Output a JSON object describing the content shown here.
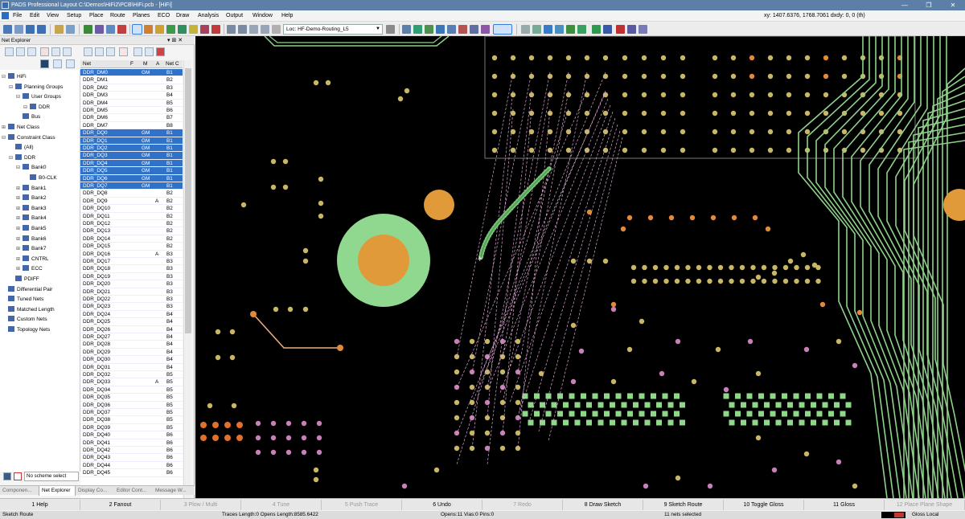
{
  "window": {
    "title": "PADS Professional Layout  C:\\Demos\\HiFi2\\PCB\\HiFi.pcb - [HiFi]",
    "min": "—",
    "restore": "❐",
    "close": "✕"
  },
  "menu": {
    "items": [
      "File",
      "Edit",
      "View",
      "Setup",
      "Place",
      "Route",
      "Planes",
      "ECO",
      "Draw",
      "Analysis",
      "Output",
      "Window",
      "Help"
    ],
    "coords": "xy: 1407.6376, 1768.7061  dxdy: 0, 0  (th)"
  },
  "toolbar": {
    "layer_select": "Loc: HF-Demo-Routing_L5"
  },
  "net_explorer": {
    "title": "Net Explorer",
    "pin": "▾ ⊞ ✕",
    "tree": [
      {
        "label": "HiFi",
        "indent": 0,
        "pm": "⊟"
      },
      {
        "label": "Planning Groups",
        "indent": 1,
        "pm": "⊟"
      },
      {
        "label": "User Groups",
        "indent": 2,
        "pm": "⊟"
      },
      {
        "label": "DDR",
        "indent": 3,
        "pm": "⊟"
      },
      {
        "label": "Bus",
        "indent": 2,
        "pm": ""
      },
      {
        "label": "Net Class",
        "indent": 0,
        "pm": "⊞"
      },
      {
        "label": "Constraint Class",
        "indent": 0,
        "pm": "⊟"
      },
      {
        "label": "(All)",
        "indent": 1,
        "pm": ""
      },
      {
        "label": "DDR",
        "indent": 1,
        "pm": "⊟"
      },
      {
        "label": "Bank0",
        "indent": 2,
        "pm": "⊟"
      },
      {
        "label": "B0-CLK",
        "indent": 3,
        "pm": ""
      },
      {
        "label": "Bank1",
        "indent": 2,
        "pm": "⊞"
      },
      {
        "label": "Bank2",
        "indent": 2,
        "pm": "⊞"
      },
      {
        "label": "Bank3",
        "indent": 2,
        "pm": "⊞"
      },
      {
        "label": "Bank4",
        "indent": 2,
        "pm": "⊞"
      },
      {
        "label": "Bank5",
        "indent": 2,
        "pm": "⊞"
      },
      {
        "label": "Bank6",
        "indent": 2,
        "pm": "⊞"
      },
      {
        "label": "Bank7",
        "indent": 2,
        "pm": "⊞"
      },
      {
        "label": "CNTRL",
        "indent": 2,
        "pm": "⊞"
      },
      {
        "label": "ECC",
        "indent": 2,
        "pm": "⊞"
      },
      {
        "label": "PDIFF",
        "indent": 1,
        "pm": ""
      },
      {
        "label": "Differential Pair",
        "indent": 0,
        "pm": ""
      },
      {
        "label": "Tuned Nets",
        "indent": 0,
        "pm": ""
      },
      {
        "label": "Matched Length",
        "indent": 0,
        "pm": ""
      },
      {
        "label": "Custom Nets",
        "indent": 0,
        "pm": ""
      },
      {
        "label": "Topology Nets",
        "indent": 0,
        "pm": ""
      }
    ],
    "grid_headers": {
      "net": "Net",
      "f": "F",
      "m": "M",
      "a": "A",
      "netc": "Net C"
    },
    "grid_rows": [
      {
        "net": "DDR_DM0",
        "f": "",
        "m": "GM",
        "a": "",
        "nc": "B1",
        "sel": true
      },
      {
        "net": "DDR_DM1",
        "f": "",
        "m": "",
        "a": "",
        "nc": "B2",
        "sel": false
      },
      {
        "net": "DDR_DM2",
        "f": "",
        "m": "",
        "a": "",
        "nc": "B3",
        "sel": false
      },
      {
        "net": "DDR_DM3",
        "f": "",
        "m": "",
        "a": "",
        "nc": "B4",
        "sel": false
      },
      {
        "net": "DDR_DM4",
        "f": "",
        "m": "",
        "a": "",
        "nc": "B5",
        "sel": false
      },
      {
        "net": "DDR_DM5",
        "f": "",
        "m": "",
        "a": "",
        "nc": "B6",
        "sel": false
      },
      {
        "net": "DDR_DM6",
        "f": "",
        "m": "",
        "a": "",
        "nc": "B7",
        "sel": false
      },
      {
        "net": "DDR_DM7",
        "f": "",
        "m": "",
        "a": "",
        "nc": "B8",
        "sel": false
      },
      {
        "net": "DDR_DQ0",
        "f": "",
        "m": "GM",
        "a": "",
        "nc": "B1",
        "sel": true
      },
      {
        "net": "DDR_DQ1",
        "f": "",
        "m": "GM",
        "a": "",
        "nc": "B1",
        "sel": true
      },
      {
        "net": "DDR_DQ2",
        "f": "",
        "m": "GM",
        "a": "",
        "nc": "B1",
        "sel": true
      },
      {
        "net": "DDR_DQ3",
        "f": "",
        "m": "GM",
        "a": "",
        "nc": "B1",
        "sel": true
      },
      {
        "net": "DDR_DQ4",
        "f": "",
        "m": "GM",
        "a": "",
        "nc": "B1",
        "sel": true
      },
      {
        "net": "DDR_DQ5",
        "f": "",
        "m": "GM",
        "a": "",
        "nc": "B1",
        "sel": true
      },
      {
        "net": "DDR_DQ6",
        "f": "",
        "m": "GM",
        "a": "",
        "nc": "B1",
        "sel": true
      },
      {
        "net": "DDR_DQ7",
        "f": "",
        "m": "GM",
        "a": "",
        "nc": "B1",
        "sel": true
      },
      {
        "net": "DDR_DQ8",
        "f": "",
        "m": "",
        "a": "",
        "nc": "B2",
        "sel": false
      },
      {
        "net": "DDR_DQ9",
        "f": "",
        "m": "",
        "a": "A",
        "nc": "B2",
        "sel": false
      },
      {
        "net": "DDR_DQ10",
        "f": "",
        "m": "",
        "a": "",
        "nc": "B2",
        "sel": false
      },
      {
        "net": "DDR_DQ11",
        "f": "",
        "m": "",
        "a": "",
        "nc": "B2",
        "sel": false
      },
      {
        "net": "DDR_DQ12",
        "f": "",
        "m": "",
        "a": "",
        "nc": "B2",
        "sel": false
      },
      {
        "net": "DDR_DQ13",
        "f": "",
        "m": "",
        "a": "",
        "nc": "B2",
        "sel": false
      },
      {
        "net": "DDR_DQ14",
        "f": "",
        "m": "",
        "a": "",
        "nc": "B2",
        "sel": false
      },
      {
        "net": "DDR_DQ15",
        "f": "",
        "m": "",
        "a": "",
        "nc": "B2",
        "sel": false
      },
      {
        "net": "DDR_DQ16",
        "f": "",
        "m": "",
        "a": "A",
        "nc": "B3",
        "sel": false
      },
      {
        "net": "DDR_DQ17",
        "f": "",
        "m": "",
        "a": "",
        "nc": "B3",
        "sel": false
      },
      {
        "net": "DDR_DQ18",
        "f": "",
        "m": "",
        "a": "",
        "nc": "B3",
        "sel": false
      },
      {
        "net": "DDR_DQ19",
        "f": "",
        "m": "",
        "a": "",
        "nc": "B3",
        "sel": false
      },
      {
        "net": "DDR_DQ20",
        "f": "",
        "m": "",
        "a": "",
        "nc": "B3",
        "sel": false
      },
      {
        "net": "DDR_DQ21",
        "f": "",
        "m": "",
        "a": "",
        "nc": "B3",
        "sel": false
      },
      {
        "net": "DDR_DQ22",
        "f": "",
        "m": "",
        "a": "",
        "nc": "B3",
        "sel": false
      },
      {
        "net": "DDR_DQ23",
        "f": "",
        "m": "",
        "a": "",
        "nc": "B3",
        "sel": false
      },
      {
        "net": "DDR_DQ24",
        "f": "",
        "m": "",
        "a": "",
        "nc": "B4",
        "sel": false
      },
      {
        "net": "DDR_DQ25",
        "f": "",
        "m": "",
        "a": "",
        "nc": "B4",
        "sel": false
      },
      {
        "net": "DDR_DQ26",
        "f": "",
        "m": "",
        "a": "",
        "nc": "B4",
        "sel": false
      },
      {
        "net": "DDR_DQ27",
        "f": "",
        "m": "",
        "a": "",
        "nc": "B4",
        "sel": false
      },
      {
        "net": "DDR_DQ28",
        "f": "",
        "m": "",
        "a": "",
        "nc": "B4",
        "sel": false
      },
      {
        "net": "DDR_DQ29",
        "f": "",
        "m": "",
        "a": "",
        "nc": "B4",
        "sel": false
      },
      {
        "net": "DDR_DQ30",
        "f": "",
        "m": "",
        "a": "",
        "nc": "B4",
        "sel": false
      },
      {
        "net": "DDR_DQ31",
        "f": "",
        "m": "",
        "a": "",
        "nc": "B4",
        "sel": false
      },
      {
        "net": "DDR_DQ32",
        "f": "",
        "m": "",
        "a": "",
        "nc": "B5",
        "sel": false
      },
      {
        "net": "DDR_DQ33",
        "f": "",
        "m": "",
        "a": "A",
        "nc": "B5",
        "sel": false
      },
      {
        "net": "DDR_DQ34",
        "f": "",
        "m": "",
        "a": "",
        "nc": "B5",
        "sel": false
      },
      {
        "net": "DDR_DQ35",
        "f": "",
        "m": "",
        "a": "",
        "nc": "B5",
        "sel": false
      },
      {
        "net": "DDR_DQ36",
        "f": "",
        "m": "",
        "a": "",
        "nc": "B5",
        "sel": false
      },
      {
        "net": "DDR_DQ37",
        "f": "",
        "m": "",
        "a": "",
        "nc": "B5",
        "sel": false
      },
      {
        "net": "DDR_DQ38",
        "f": "",
        "m": "",
        "a": "",
        "nc": "B5",
        "sel": false
      },
      {
        "net": "DDR_DQ39",
        "f": "",
        "m": "",
        "a": "",
        "nc": "B5",
        "sel": false
      },
      {
        "net": "DDR_DQ40",
        "f": "",
        "m": "",
        "a": "",
        "nc": "B6",
        "sel": false
      },
      {
        "net": "DDR_DQ41",
        "f": "",
        "m": "",
        "a": "",
        "nc": "B6",
        "sel": false
      },
      {
        "net": "DDR_DQ42",
        "f": "",
        "m": "",
        "a": "",
        "nc": "B6",
        "sel": false
      },
      {
        "net": "DDR_DQ43",
        "f": "",
        "m": "",
        "a": "",
        "nc": "B6",
        "sel": false
      },
      {
        "net": "DDR_DQ44",
        "f": "",
        "m": "",
        "a": "",
        "nc": "B6",
        "sel": false
      },
      {
        "net": "DDR_DQ45",
        "f": "",
        "m": "",
        "a": "",
        "nc": "B6",
        "sel": false
      }
    ],
    "scheme": "No scheme select",
    "tabs": [
      "Componen...",
      "Net Explorer",
      "Display Co...",
      "Editor Cont...",
      "Message W..."
    ]
  },
  "fkeys": [
    {
      "label": "1 Help",
      "dis": false
    },
    {
      "label": "2 Fanout",
      "dis": false
    },
    {
      "label": "3 Plow / Multi",
      "dis": true
    },
    {
      "label": "4 Tune",
      "dis": true
    },
    {
      "label": "5 Push Trace",
      "dis": true
    },
    {
      "label": "6 Undo",
      "dis": false
    },
    {
      "label": "7 Redo",
      "dis": true
    },
    {
      "label": "8 Draw Sketch",
      "dis": false
    },
    {
      "label": "9 Sketch Route",
      "dis": false
    },
    {
      "label": "10 Toggle Gloss",
      "dis": false
    },
    {
      "label": "11 Gloss",
      "dis": false
    },
    {
      "label": "12 Place Plane Shape",
      "dis": true
    }
  ],
  "status": {
    "mode": "Sketch Route",
    "lengths": "Traces Length:0 Opens Length:8585.6422",
    "opens": "Opens:11 Vias:0 Pins:0",
    "nets": "11 nets selected",
    "gloss": "Gloss Local"
  },
  "colors": {
    "board_bg": "#000000",
    "trace": "#8fd18a",
    "pad_gold": "#c9b766",
    "pad_orange": "#e08a3a",
    "pad_pink": "#c780b8",
    "ratsnest": "#d9a6d0",
    "selection": "#2f72c8"
  }
}
